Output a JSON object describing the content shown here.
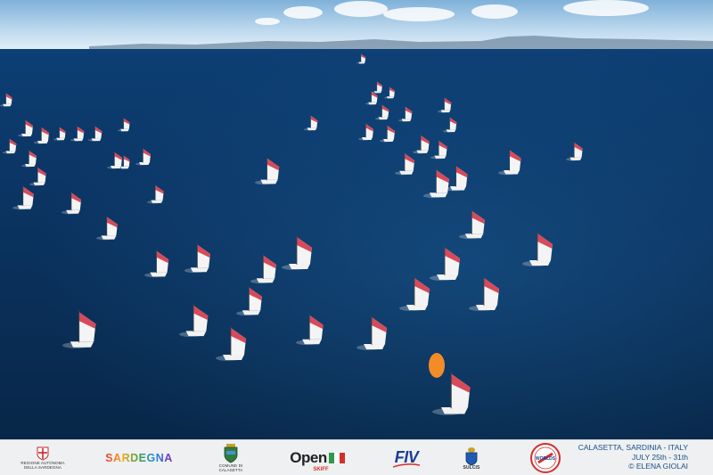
{
  "photo": {
    "subject": "sailing-regatta-aerial",
    "colors": {
      "sea_deep": "#0a2f57",
      "sea_mid": "#134a7e",
      "sky": "#cfe3f2",
      "sail_red": "#d64a5a",
      "sail_white": "#f4f4f4"
    }
  },
  "footer": {
    "sponsors": [
      {
        "name": "regione-sardegna",
        "caption_line1": "REGIONE AUTONOMA",
        "caption_line2": "DELLA SARDEGNA"
      },
      {
        "name": "sardegna",
        "text": "SARDEGNA"
      },
      {
        "name": "comune-calasetta",
        "caption": "COMUNE DI CALASETTA"
      },
      {
        "name": "open-skiff",
        "text": "Open",
        "subtext": "SKIFF"
      },
      {
        "name": "fiv",
        "text": "FIV"
      },
      {
        "name": "sulcis",
        "text": "SULCIS"
      },
      {
        "name": "worlds-badge",
        "text": "WORLDS"
      }
    ],
    "credit": {
      "line1": "CALASETTA, SARDINIA - ITALY",
      "line2": "JULY 25th - 31th",
      "line3": "© ELENA GIOLAI"
    }
  }
}
